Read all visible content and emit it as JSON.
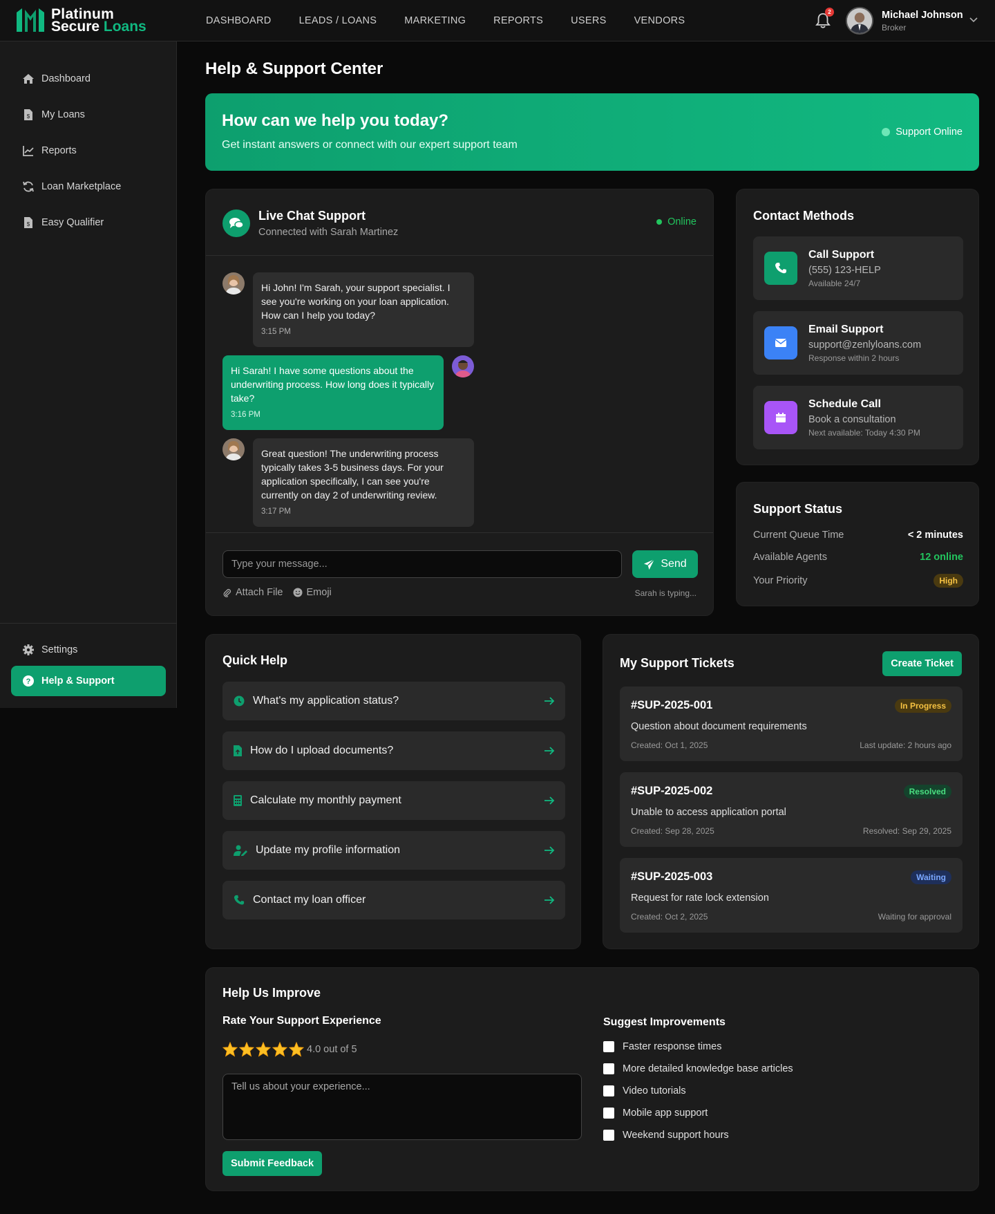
{
  "brand": {
    "line1": "Platinum",
    "line2a": "Secure ",
    "line2b": "Loans",
    "accent": "#10b981"
  },
  "topnav": [
    "DASHBOARD",
    "LEADS / LOANS",
    "MARKETING",
    "REPORTS",
    "USERS",
    "VENDORS"
  ],
  "notifications": {
    "count": "2"
  },
  "user": {
    "name": "Michael Johnson",
    "role": "Broker"
  },
  "sidebar": {
    "items": [
      {
        "label": "Dashboard",
        "icon": "home-icon"
      },
      {
        "label": "My Loans",
        "icon": "file-dollar-icon"
      },
      {
        "label": "Reports",
        "icon": "chart-line-icon"
      },
      {
        "label": "Loan Marketplace",
        "icon": "refresh-icon"
      },
      {
        "label": "Easy Qualifier",
        "icon": "file-dollar-icon"
      }
    ],
    "bottom": [
      {
        "label": "Settings",
        "icon": "gear-icon"
      },
      {
        "label": "Help & Support",
        "icon": "question-icon",
        "active": true
      }
    ]
  },
  "page": {
    "title": "Help & Support Center"
  },
  "hero": {
    "title": "How can we help you today?",
    "subtitle": "Get instant answers or connect with our expert support team",
    "status": "Support Online"
  },
  "chat": {
    "title": "Live Chat Support",
    "subtitle": "Connected with Sarah Martinez",
    "status": "Online",
    "messages": [
      {
        "from": "agent",
        "text": "Hi John! I'm Sarah, your support specialist. I see you're working on your loan application. How can I help you today?",
        "time": "3:15 PM"
      },
      {
        "from": "user",
        "text": "Hi Sarah! I have some questions about the underwriting process. How long does it typically take?",
        "time": "3:16 PM"
      },
      {
        "from": "agent",
        "text": "Great question! The underwriting process typically takes 3-5 business days. For your application specifically, I can see you're currently on day 2 of underwriting review.",
        "time": "3:17 PM"
      }
    ],
    "input_placeholder": "Type your message...",
    "send_label": "Send",
    "attach_label": "Attach File",
    "emoji_label": "Emoji",
    "typing": "Sarah is typing..."
  },
  "contact": {
    "title": "Contact Methods",
    "methods": [
      {
        "title": "Call Support",
        "value": "(555) 123-HELP",
        "note": "Available 24/7",
        "color": "#0e9f6e",
        "icon": "phone-icon"
      },
      {
        "title": "Email Support",
        "value": "support@zenlyloans.com",
        "note": "Response within 2 hours",
        "color": "#3b82f6",
        "icon": "envelope-icon"
      },
      {
        "title": "Schedule Call",
        "value": "Book a consultation",
        "note": "Next available: Today 4:30 PM",
        "color": "#a855f7",
        "icon": "calendar-icon"
      }
    ]
  },
  "support_status": {
    "title": "Support Status",
    "rows": [
      {
        "label": "Current Queue Time",
        "value": "< 2 minutes"
      },
      {
        "label": "Available Agents",
        "value": "12 online"
      },
      {
        "label": "Your Priority",
        "value": "High"
      }
    ]
  },
  "quick_help": {
    "title": "Quick Help",
    "items": [
      {
        "label": "What's my application status?",
        "icon": "clock-icon"
      },
      {
        "label": "How do I upload documents?",
        "icon": "file-upload-icon"
      },
      {
        "label": "Calculate my monthly payment",
        "icon": "calculator-icon"
      },
      {
        "label": "Update my profile information",
        "icon": "user-edit-icon"
      },
      {
        "label": "Contact my loan officer",
        "icon": "phone-icon"
      }
    ]
  },
  "tickets": {
    "title": "My Support Tickets",
    "create_label": "Create Ticket",
    "items": [
      {
        "id": "#SUP-2025-001",
        "status": "In Progress",
        "desc": "Question about document requirements",
        "created": "Created: Oct 1, 2025",
        "update": "Last update: 2 hours ago"
      },
      {
        "id": "#SUP-2025-002",
        "status": "Resolved",
        "desc": "Unable to access application portal",
        "created": "Created: Sep 28, 2025",
        "update": "Resolved: Sep 29, 2025"
      },
      {
        "id": "#SUP-2025-003",
        "status": "Waiting",
        "desc": "Request for rate lock extension",
        "created": "Created: Oct 2, 2025",
        "update": "Waiting for approval"
      }
    ]
  },
  "improve": {
    "title": "Help Us Improve",
    "rate_title": "Rate Your Support Experience",
    "rating": 4.0,
    "rating_text": "4.0 out of 5",
    "feedback_placeholder": "Tell us about your experience...",
    "submit_label": "Submit Feedback",
    "suggest_title": "Suggest Improvements",
    "suggestions": [
      "Faster response times",
      "More detailed knowledge base articles",
      "Video tutorials",
      "Mobile app support",
      "Weekend support hours"
    ]
  }
}
